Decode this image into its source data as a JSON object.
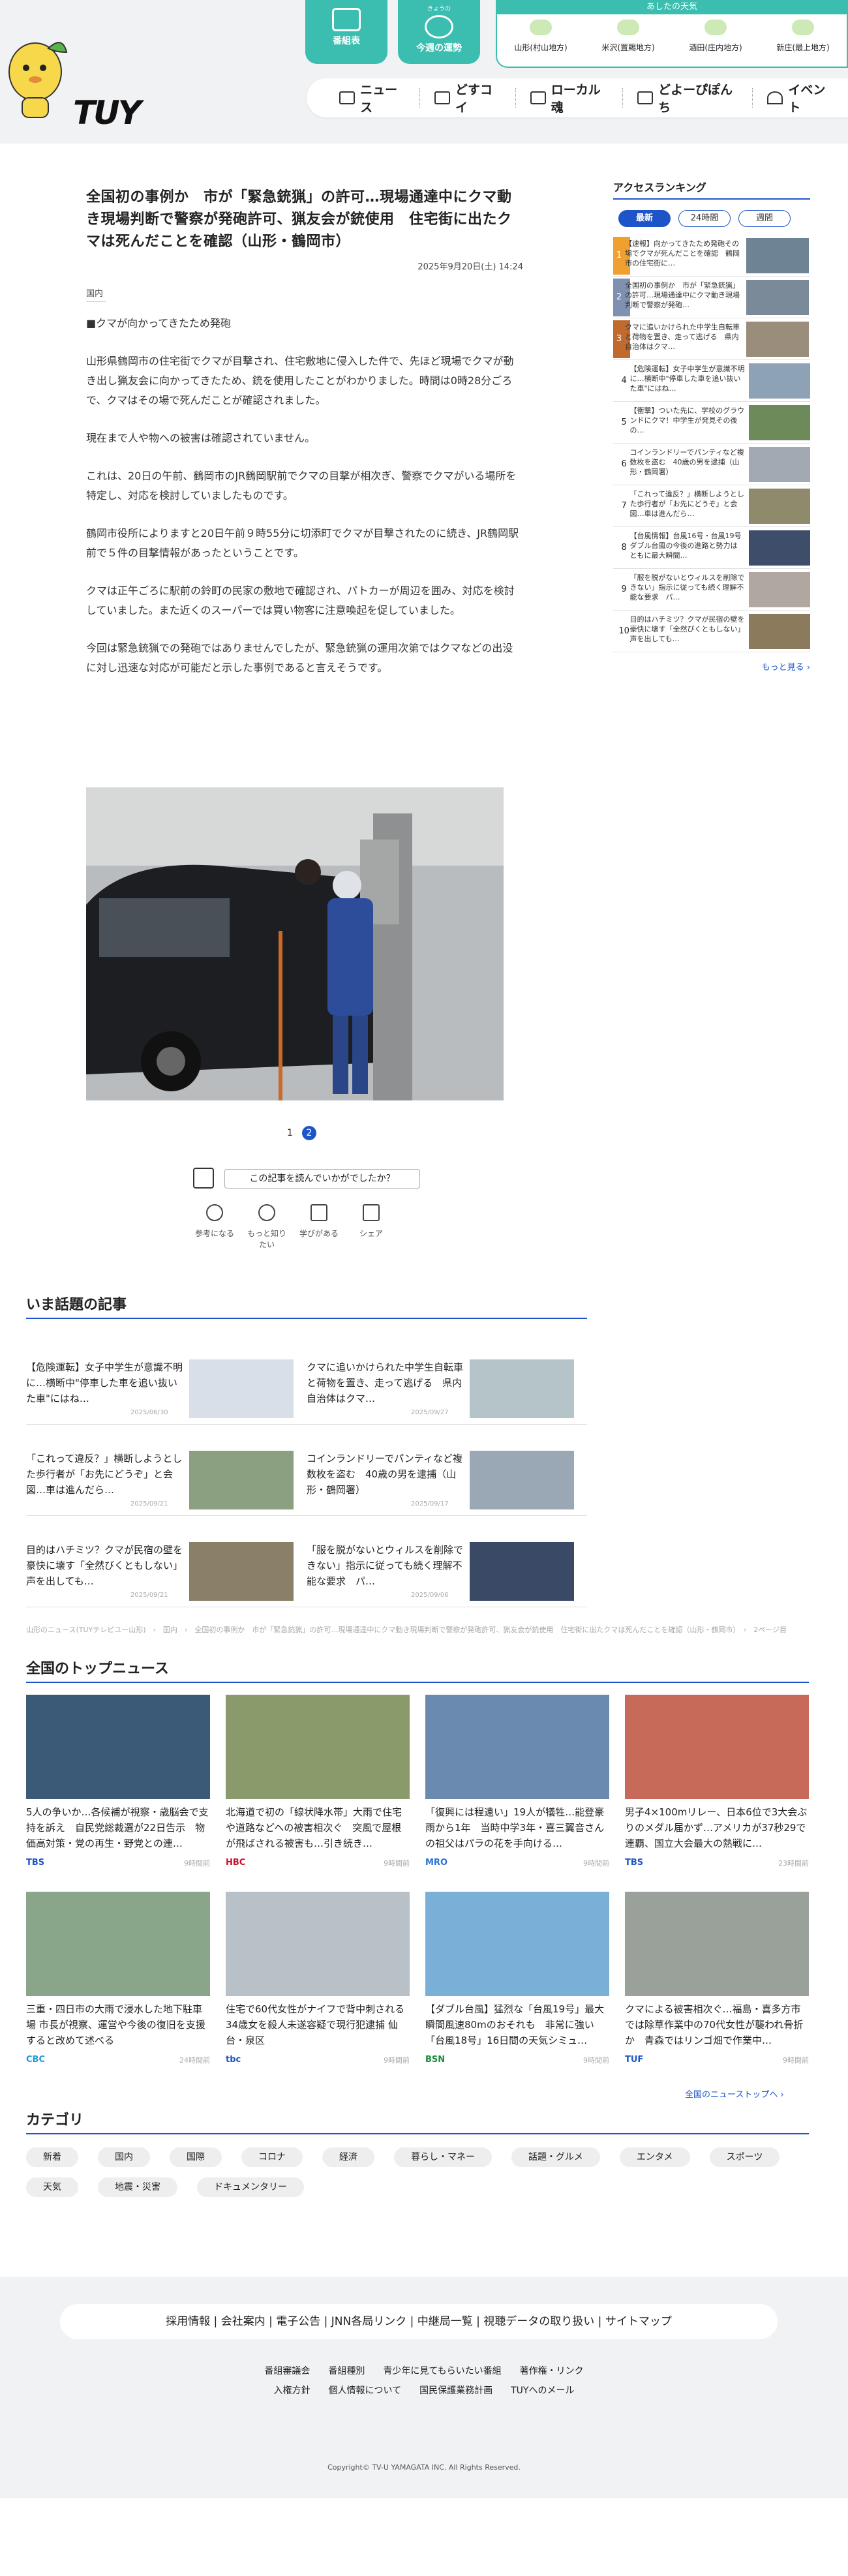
{
  "top_buttons": [
    {
      "label": "番組表",
      "sub": ""
    },
    {
      "label": "今週の運勢",
      "sub": "きょうの"
    }
  ],
  "weather": {
    "title": "あしたの天気",
    "cells": [
      "山形(村山地方)",
      "米沢(置賜地方)",
      "酒田(庄内地方)",
      "新庄(最上地方)"
    ]
  },
  "nav": [
    "ニュース",
    "どすコイ",
    "ローカル魂",
    "どよーぴぽんち",
    "イベント"
  ],
  "article": {
    "title": "全国初の事例か　市が「緊急銃猟」の許可…現場通達中にクマ動き現場判断で警察が発砲許可、猟友会が銃使用　住宅街に出たクマは死んだことを確認（山形・鶴岡市）",
    "date": "2025年9月20日(土) 14:24",
    "category": "国内",
    "body": [
      "■クマが向かってきたため発砲",
      "山形県鶴岡市の住宅街でクマが目撃され、住宅敷地に侵入した件で、先ほど現場でクマが動き出し猟友会に向かってきたため、銃を使用したことがわかりました。時間は0時28分ごろで、クマはその場で死んだことが確認されました。",
      "現在まで人や物への被害は確認されていません。",
      "これは、20日の午前、鶴岡市のJR鶴岡駅前でクマの目撃が相次ぎ、警察でクマがいる場所を特定し、対応を検討していましたものです。",
      "鶴岡市役所によりますと20日午前９時55分に切添町でクマが目撃されたのに続き、JR鶴岡駅前で５件の目撃情報があったということです。",
      "クマは正午ごろに駅前の鈴町の民家の敷地で確認され、パトカーが周辺を囲み、対応を検討していました。また近くのスーパーでは買い物客に注意喚起を促していました。",
      "今回は緊急銃猟での発砲ではありませんでしたが、緊急銃猟の運用次第ではクマなどの出没に対し迅速な対応が可能だと示した事例であると言えそうです。"
    ],
    "pager": [
      "1",
      "2"
    ],
    "feedback": "この記事を読んでいかがでしたか？",
    "reactions": [
      "参考になる",
      "もっと知りたい",
      "学びがある",
      "シェア"
    ]
  },
  "ranking": {
    "title": "アクセスランキング",
    "tabs": [
      "最新",
      "24時間",
      "週間"
    ],
    "items": [
      {
        "n": "1",
        "text": "【速報】向かってきたため発砲その場でクマが死んだことを確認　鶴岡市の住宅街に…",
        "color": "#f0a030"
      },
      {
        "n": "2",
        "text": "全国初の事例か　市が「緊急銃猟」の許可…現場通達中にクマ動き現場判断で警察が発砲…",
        "color": "#8090b0"
      },
      {
        "n": "3",
        "text": "クマに追いかけられた中学生自転車と荷物を置き、走って逃げる　県内自治体はクマ…",
        "color": "#c06a30"
      },
      {
        "n": "4",
        "text": "【危険運転】女子中学生が意識不明に…横断中\"停車した車を追い抜いた車\"にはね…",
        "color": "#fff"
      },
      {
        "n": "5",
        "text": "【衝撃】ついた先に、学校のグラウンドにクマ！中学生が発見その後の…",
        "color": "#fff"
      },
      {
        "n": "6",
        "text": "コインランドリーでパンティなど複数枚を盗む　40歳の男を逮捕（山形・鶴岡署）",
        "color": "#fff"
      },
      {
        "n": "7",
        "text": "「これって違反？」横断しようとした歩行者が「お先にどうぞ」と会図…車は進んだら…",
        "color": "#fff"
      },
      {
        "n": "8",
        "text": "【台風情報】台風16号・台風19号　ダブル台風の今後の進路と勢力は　ともに最大瞬間…",
        "color": "#fff"
      },
      {
        "n": "9",
        "text": "「服を脱がないとウィルスを削除できない」指示に従っても続く理解不能な要求　パ…",
        "color": "#fff"
      },
      {
        "n": "10",
        "text": "目的はハチミツ？クマが民宿の壁を豪快に壊す「全然びくともしない」声を出しても…",
        "color": "#fff"
      }
    ],
    "more": "もっと見る ›"
  },
  "hot": {
    "title": "いま話題の記事",
    "items": [
      {
        "t": "【危険運転】女子中学生が意識不明に…横断中\"停車した車を追い抜いた車\"にはね…",
        "d": "2025/06/30"
      },
      {
        "t": "クマに追いかけられた中学生自転車と荷物を置き、走って逃げる　県内自治体はクマ…",
        "d": "2025/09/27"
      },
      {
        "t": "「これって違反？」横断しようとした歩行者が「お先にどうぞ」と会図…車は進んだら…",
        "d": "2025/09/21"
      },
      {
        "t": "コインランドリーでパンティなど複数枚を盗む　40歳の男を逮捕（山形・鶴岡署）",
        "d": "2025/09/17"
      },
      {
        "t": "目的はハチミツ？クマが民宿の壁を豪快に壊す「全然びくともしない」声を出しても…",
        "d": "2025/09/21"
      },
      {
        "t": "「服を脱がないとウィルスを削除できない」指示に従っても続く理解不能な要求　パ…",
        "d": "2025/09/06"
      }
    ]
  },
  "breadcrumb": "山形のニュース(TUYテレビユー山形)　›　国内　›　全国初の事例か　市が「緊急銃猟」の許可…現場通達中にクマ動き現場判断で警察が発砲許可、猟友会が銃使用　住宅街に出たクマは死んだことを確認（山形・鶴岡市）　›　2ページ目",
  "top_news": {
    "title": "全国のトップニュース",
    "items": [
      {
        "t": "5人の争いか…各候補が視察・歳脳会で支持を訴え　自民党総裁選が22日告示　物価高対策・党の再生・野党との連…",
        "s": "TBS",
        "d": "9時間前",
        "c": "#1d55c9"
      },
      {
        "t": "北海道で初の「線状降水帯」大雨で住宅や道路などへの被害相次ぐ　突風で屋根が飛ばされる被害も…引き続き…",
        "s": "HBC",
        "d": "9時間前",
        "c": "#c8102e"
      },
      {
        "t": "「復興には程遠い」19人が犠牲…能登豪雨から1年　当時中学3年・喜三翼音さんの祖父はパラの花を手向ける…",
        "s": "MRO",
        "d": "9時間前",
        "c": "#2a6fd6"
      },
      {
        "t": "男子4×100mリレー、日本6位で3大会ぶりのメダル届かず…アメリカが37秒29で連覇、国立大会最大の熱戦に…",
        "s": "TBS",
        "d": "23時間前",
        "c": "#1d55c9"
      },
      {
        "t": "三重・四日市の大雨で浸水した地下駐車場 市長が視察、運営や今後の復旧を支援すると改めて述べる",
        "s": "CBC",
        "d": "24時間前",
        "c": "#1d9bd6"
      },
      {
        "t": "住宅で60代女性がナイフで背中刺される 34歳女を殺人未遂容疑で現行犯逮捕 仙台・泉区",
        "s": "tbc",
        "d": "9時間前",
        "c": "#1d55c9"
      },
      {
        "t": "【ダブル台風】猛烈な「台風19号」最大瞬間風速80mのおそれも　非常に強い「台風18号」16日間の天気シミュ…",
        "s": "BSN",
        "d": "9時間前",
        "c": "#1a8c3a"
      },
      {
        "t": "クマによる被害相次ぐ…福島・喜多方市では除草作業中の70代女性が襲われ骨折か　青森ではリンゴ畑で作業中…",
        "s": "TUF",
        "d": "9時間前",
        "c": "#1d55c9"
      }
    ],
    "more": "全国のニューストップへ ›"
  },
  "categories": {
    "title": "カテゴリ",
    "items": [
      "新着",
      "国内",
      "国際",
      "コロナ",
      "経済",
      "暮らし・マネー",
      "話題・グルメ",
      "エンタメ",
      "スポーツ",
      "天気",
      "地震・災害",
      "ドキュメンタリー"
    ]
  },
  "footer": {
    "bar": "採用情報 | 会社案内 | 電子公告 | JNN各局リンク | 中継局一覧 | 視聴データの取り扱い | サイトマップ",
    "links1": "番組審議会　　番組種別　　青少年に見てもらいたい番組　　著作権・リンク",
    "links2": "入権方針　　個人情報について　　国民保護業務計画　　TUYへのメール",
    "copyright": "Copyright© TV-U YAMAGATA INC. All Rights Reserved."
  },
  "logo": "TUY"
}
